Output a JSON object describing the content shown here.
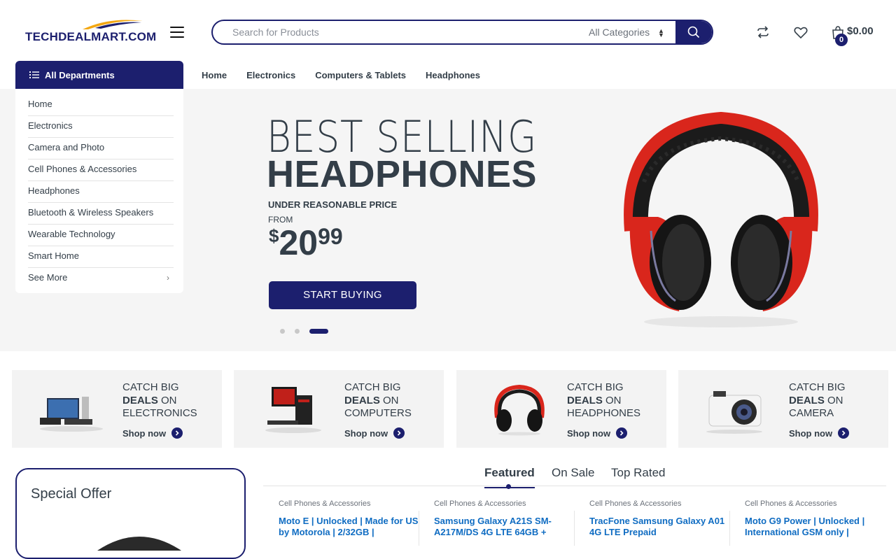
{
  "header": {
    "logo_text_a": "TECHDEAL",
    "logo_text_b": "MART.COM",
    "menu_icon": "hamburger-icon",
    "search": {
      "placeholder": "Search for Products",
      "category": "All Categories",
      "button_icon": "search-icon"
    },
    "icons": [
      "compare-icon",
      "heart-icon",
      "shopping-bag-icon"
    ],
    "cart_count": "0",
    "cart_total": "$0.00"
  },
  "departments": {
    "button_label": "All Departments",
    "items": [
      {
        "label": "Home"
      },
      {
        "label": "Electronics"
      },
      {
        "label": "Camera and Photo"
      },
      {
        "label": "Cell Phones & Accessories"
      },
      {
        "label": "Headphones"
      },
      {
        "label": "Bluetooth & Wireless Speakers"
      },
      {
        "label": "Wearable Technology"
      },
      {
        "label": "Smart Home"
      },
      {
        "label": "See More"
      }
    ]
  },
  "topnav": {
    "items": [
      {
        "label": "Home"
      },
      {
        "label": "Electronics"
      },
      {
        "label": "Computers & Tablets"
      },
      {
        "label": "Headphones"
      }
    ]
  },
  "hero": {
    "line1": "BEST SELLING",
    "line2": "HEADPHONES",
    "subtitle": "UNDER REASONABLE PRICE",
    "from": "FROM",
    "price_currency": "$",
    "price_int": "20",
    "price_dec": "99",
    "button": "START BUYING",
    "slides": 3,
    "active_slide": 3
  },
  "deals": [
    {
      "line1": "CATCH BIG",
      "bold": "DEALS",
      "on": " ON",
      "line3": "ELECTRONICS",
      "shop": "Shop now"
    },
    {
      "line1": "CATCH BIG",
      "bold": "DEALS",
      "on": " ON",
      "line3": "COMPUTERS",
      "shop": "Shop now"
    },
    {
      "line1": "CATCH BIG",
      "bold": "DEALS",
      "on": " ON",
      "line3": "HEADPHONES",
      "shop": "Shop now"
    },
    {
      "line1": "CATCH BIG",
      "bold": "DEALS",
      "on": " ON",
      "line3": "CAMERA",
      "shop": "Shop now"
    }
  ],
  "special_offer": {
    "title": "Special Offer"
  },
  "tabs": [
    {
      "label": "Featured"
    },
    {
      "label": "On Sale"
    },
    {
      "label": "Top Rated"
    }
  ],
  "products": [
    {
      "category": "Cell Phones & Accessories",
      "name": "Moto E | Unlocked | Made for US by Motorola | 2/32GB |"
    },
    {
      "category": "Cell Phones & Accessories",
      "name": "Samsung Galaxy A21S SM-A217M/DS 4G LTE 64GB +"
    },
    {
      "category": "Cell Phones & Accessories",
      "name": "TracFone Samsung Galaxy A01 4G LTE Prepaid"
    },
    {
      "category": "Cell Phones & Accessories",
      "name": "Moto G9 Power | Unlocked | International GSM only |"
    }
  ],
  "colors": {
    "primary": "#1c1f6e",
    "link": "#0f6cc2",
    "text": "#333e48",
    "hero_bg": "#f5f5f5"
  }
}
